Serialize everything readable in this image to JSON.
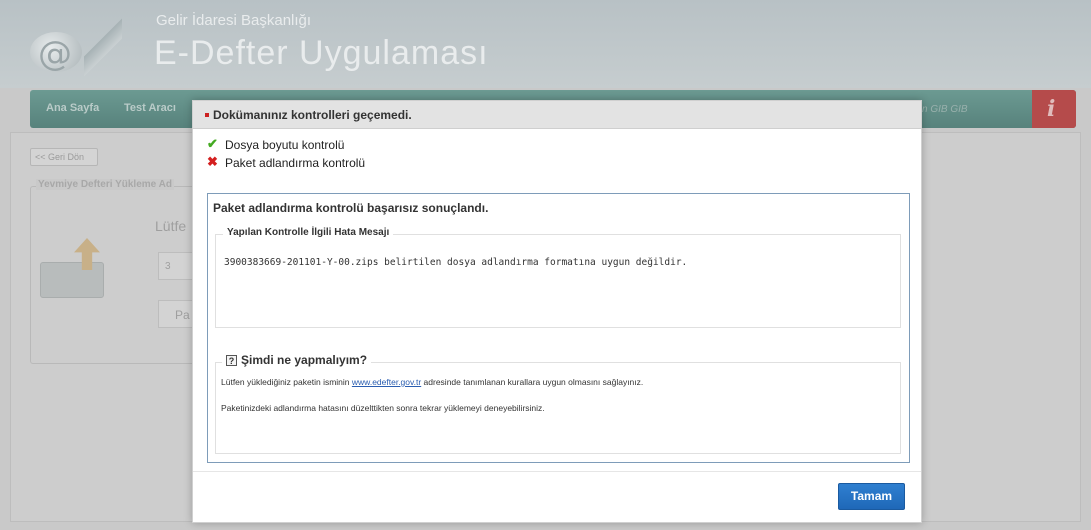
{
  "background": {
    "org_name": "Gelir İdaresi Başkanlığı",
    "app_name": "E-Defter Uygulaması",
    "nav": {
      "items": [
        "Ana Sayfa",
        "Test Aracı"
      ],
      "user": "n GIB GIB"
    },
    "back_button": "<< Geri Dön",
    "legend": "Yevmiye Defteri Yükleme Ad",
    "lutfen": "Lütfe",
    "file_field": "3",
    "button": "Pa"
  },
  "dialog": {
    "title": "Dokümanınız kontrolleri geçemedi.",
    "checks": [
      {
        "label": "Dosya boyutu kontrolü",
        "status": "ok",
        "icon": "check-icon"
      },
      {
        "label": "Paket adlandırma kontrolü",
        "status": "fail",
        "icon": "cross-icon"
      }
    ],
    "result_title": "Paket adlandırma kontrolü başarısız sonuçlandı.",
    "error_section": {
      "legend": "Yapılan Kontrolle İlgili Hata Mesajı",
      "message": "3900383669-201101-Y-00.zips belirtilen dosya adlandırma formatına uygun değildir."
    },
    "help_section": {
      "legend": "Şimdi ne yapmalıyım?",
      "line1_before": "Lütfen yüklediğiniz paketin isminin ",
      "line1_link": "www.edefter.gov.tr",
      "line1_after": " adresinde tanımlanan kurallara uygun olmasını sağlayınız.",
      "line2": "Paketinizdeki adlandırma hatasını düzelttikten sonra tekrar yüklemeyi deneyebilirsiniz."
    },
    "ok_button": "Tamam"
  },
  "colors": {
    "nav": "#6c9a92",
    "exit": "#b54b4b",
    "ok_button": "#2574c6",
    "panel_border": "#7e9cb9",
    "error_bullet": "#cc2222"
  }
}
